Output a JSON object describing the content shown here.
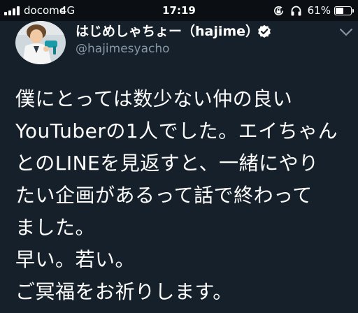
{
  "status_bar": {
    "carrier": "docomo",
    "network": "4G",
    "time": "17:19",
    "battery_percent": "61%",
    "battery_level": 0.61,
    "icons": [
      "signal-bars-icon",
      "rotation-lock-icon",
      "headphones-icon",
      "battery-icon"
    ]
  },
  "tweet": {
    "display_name": "はじめしゃちょー（hajime）",
    "username": "@hajimesyacho",
    "verified": true,
    "lines": [
      "僕にとっては数少ない仲の良い",
      "YouTuberの1人でした。エイちゃん",
      "とのLINEを見返すと、一緒にやり",
      "たい企画があるって話で終わって",
      "ました。",
      "早い。若い。",
      "ご冥福をお祈りします。"
    ]
  },
  "colors": {
    "background": "#15202b",
    "status_bar": "#0b0f14",
    "text_primary": "#ffffff",
    "text_secondary": "#8899a6",
    "verified": "#ffffff"
  }
}
